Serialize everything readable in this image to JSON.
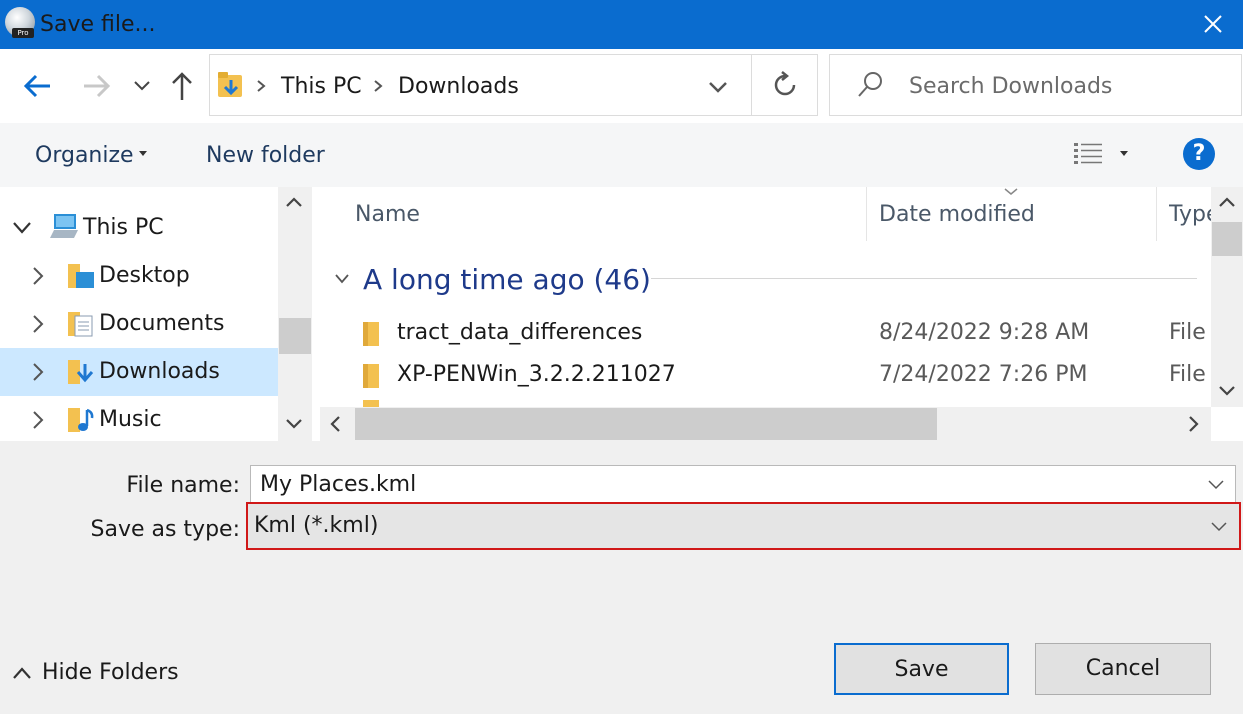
{
  "window": {
    "title": "Save file...",
    "app_badge": "Pro"
  },
  "nav": {
    "breadcrumb": [
      "This PC",
      "Downloads"
    ],
    "search_placeholder": "Search Downloads"
  },
  "commands": {
    "organize": "Organize",
    "new_folder": "New folder",
    "help": "?"
  },
  "tree": [
    {
      "label": "This PC",
      "icon": "computer-icon",
      "expanded": true,
      "selected": false
    },
    {
      "label": "Desktop",
      "icon": "desktop-folder-icon",
      "expanded": false,
      "selected": false
    },
    {
      "label": "Documents",
      "icon": "documents-folder-icon",
      "expanded": false,
      "selected": false
    },
    {
      "label": "Downloads",
      "icon": "downloads-folder-icon",
      "expanded": false,
      "selected": true
    },
    {
      "label": "Music",
      "icon": "music-folder-icon",
      "expanded": false,
      "selected": false
    }
  ],
  "columns": [
    "Name",
    "Date modified",
    "Type"
  ],
  "group": {
    "label": "A long time ago (46)"
  },
  "files": [
    {
      "name": "tract_data_differences",
      "date": "8/24/2022 9:28 AM",
      "type": "File"
    },
    {
      "name": "XP-PENWin_3.2.2.211027",
      "date": "7/24/2022 7:26 PM",
      "type": "File"
    }
  ],
  "form": {
    "file_name_label": "File name:",
    "file_name_value": "My Places.kml",
    "save_type_label": "Save as type:",
    "save_type_value": "Kml (*.kml)"
  },
  "buttons": {
    "save": "Save",
    "cancel": "Cancel",
    "hide_folders": "Hide Folders"
  },
  "colors": {
    "titlebar": "#0a6ccf",
    "selection": "#cce8ff",
    "highlight_border": "#d01818"
  }
}
